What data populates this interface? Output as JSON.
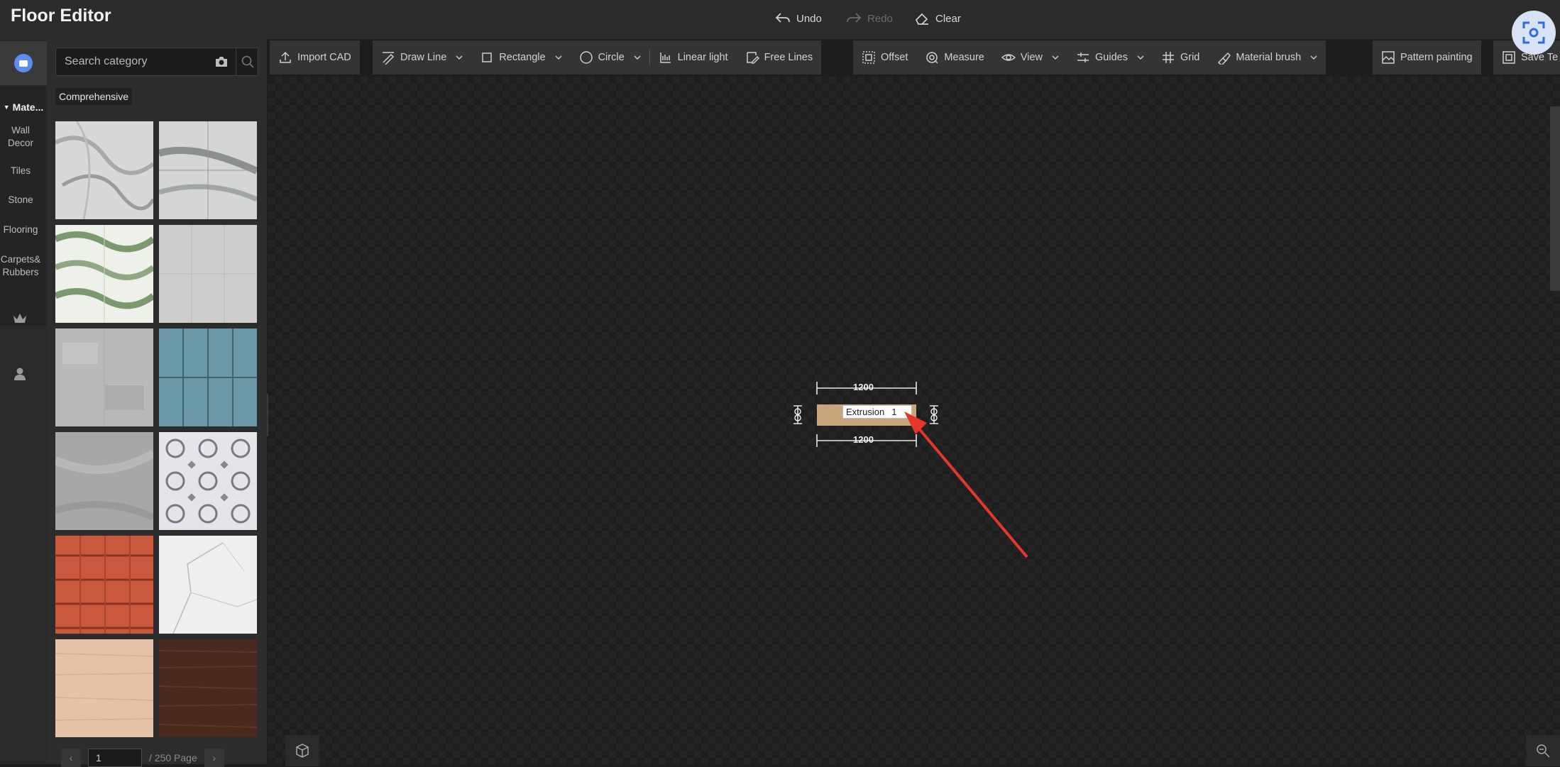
{
  "app": {
    "title": "Floor Editor"
  },
  "history": {
    "undo": "Undo",
    "redo": "Redo",
    "clear": "Clear"
  },
  "rail": {
    "section": "Mate...",
    "items": [
      "Wall Decor",
      "Tiles",
      "Stone",
      "Flooring",
      "Carpets& Rubbers"
    ]
  },
  "panel": {
    "search_placeholder": "Search category",
    "tab": "Comprehensive",
    "materials": [
      {
        "icon": "grey-marble-swirl",
        "color": "#d8d8d8"
      },
      {
        "icon": "white-grey-marble-tiles",
        "color": "#d4d6d6"
      },
      {
        "icon": "green-onyx-marble",
        "color": "#c9d5c2"
      },
      {
        "icon": "light-grey-plain-tiles",
        "color": "#cfcdcb"
      },
      {
        "icon": "grey-concrete",
        "color": "#b9b9bb"
      },
      {
        "icon": "teal-blue-tiles",
        "color": "#6a98a6"
      },
      {
        "icon": "grey-stone",
        "color": "#a7a7a5"
      },
      {
        "icon": "patterned-cement-tiles",
        "color": "#c9c7cc"
      },
      {
        "icon": "terracotta-roof-tiles",
        "color": "#c9583f"
      },
      {
        "icon": "white-calacatta-marble",
        "color": "#eef0f0"
      },
      {
        "icon": "peach-wood",
        "color": "#e6c2a6"
      },
      {
        "icon": "dark-walnut-wood",
        "color": "#4a2a1e"
      }
    ],
    "pager": {
      "page_value": "1",
      "total": "/ 250 Page"
    }
  },
  "toolbar": {
    "import_cad": "Import CAD",
    "draw_line": "Draw Line",
    "rectangle": "Rectangle",
    "circle": "Circle",
    "linear_light": "Linear light",
    "free_lines": "Free Lines",
    "offset": "Offset",
    "measure": "Measure",
    "view": "View",
    "guides": "Guides",
    "grid": "Grid",
    "material_brush": "Material brush",
    "pattern_painting": "Pattern painting",
    "save_template": "Save Te"
  },
  "canvas": {
    "dim_top": "1200",
    "dim_bottom": "1200",
    "extrusion_label": "Extrusion",
    "extrusion_value": "1",
    "shape_color": "#c8a47c",
    "annotation_color": "#e8352a"
  }
}
